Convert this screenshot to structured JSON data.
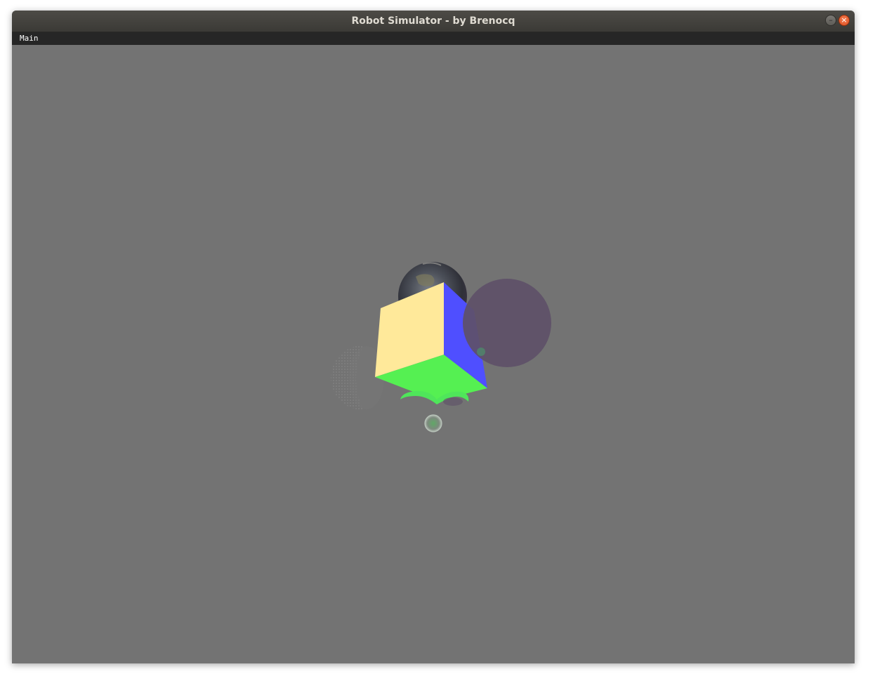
{
  "window": {
    "title": "Robot Simulator - by Brenocq",
    "minimize_glyph": "–",
    "close_glyph": "×"
  },
  "menubar": {
    "items": [
      {
        "label": "Main"
      }
    ]
  },
  "scene": {
    "background_color": "#737373",
    "objects": [
      {
        "name": "textured-earth-sphere",
        "color": "#4a4e5a"
      },
      {
        "name": "cube",
        "face_colors": {
          "front": "#ffe99a",
          "side": "#4f4fff",
          "bottom": "#55f052"
        }
      },
      {
        "name": "translucent-purple-sphere",
        "color": "#5e5068"
      },
      {
        "name": "faint-dotted-sphere",
        "color": "#8a8a8a"
      },
      {
        "name": "small-green-sphere",
        "color": "#6f8f70"
      }
    ]
  }
}
